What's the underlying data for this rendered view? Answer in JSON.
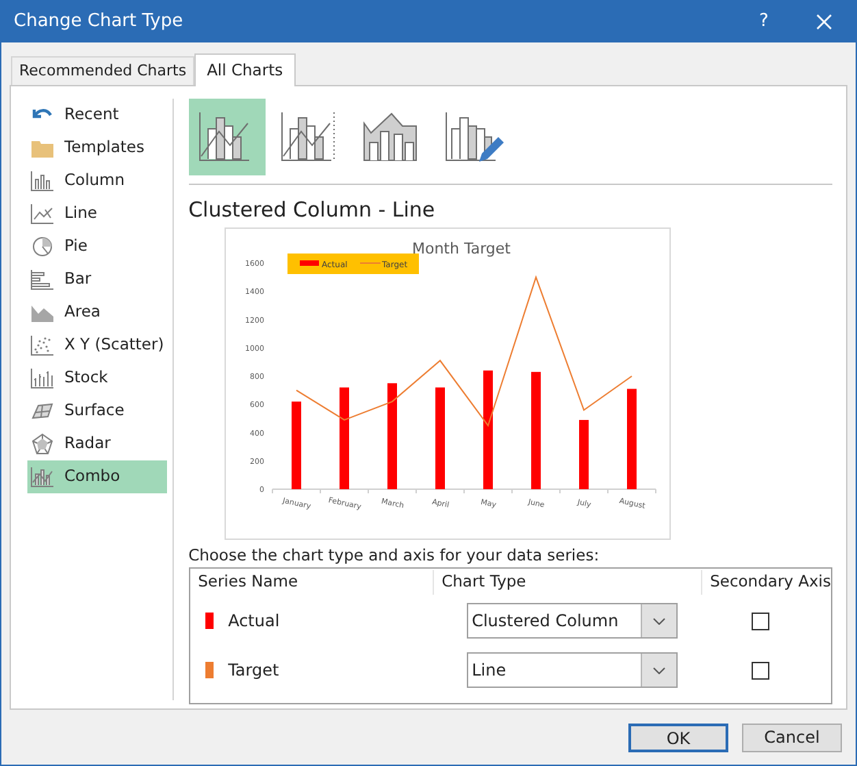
{
  "window": {
    "title": "Change Chart Type",
    "help": "?"
  },
  "tabs": [
    {
      "label": "Recommended Charts",
      "selected": false
    },
    {
      "label": "All Charts",
      "selected": true
    }
  ],
  "sidebar": {
    "items": [
      {
        "label": "Recent",
        "kind": "recent",
        "selected": false
      },
      {
        "label": "Templates",
        "kind": "templates",
        "selected": false
      },
      {
        "label": "Column",
        "kind": "column",
        "selected": false
      },
      {
        "label": "Line",
        "kind": "line",
        "selected": false
      },
      {
        "label": "Pie",
        "kind": "pie",
        "selected": false
      },
      {
        "label": "Bar",
        "kind": "bar",
        "selected": false
      },
      {
        "label": "Area",
        "kind": "area",
        "selected": false
      },
      {
        "label": "X Y (Scatter)",
        "kind": "scatter",
        "selected": false
      },
      {
        "label": "Stock",
        "kind": "stock",
        "selected": false
      },
      {
        "label": "Surface",
        "kind": "surface",
        "selected": false
      },
      {
        "label": "Radar",
        "kind": "radar",
        "selected": false
      },
      {
        "label": "Combo",
        "kind": "combo",
        "selected": true
      }
    ]
  },
  "subtypes": [
    {
      "kind": "column-line",
      "selected": true
    },
    {
      "kind": "column-line-secondary",
      "selected": false
    },
    {
      "kind": "area-column",
      "selected": false
    },
    {
      "kind": "custom",
      "selected": false
    }
  ],
  "subtype_title": "Clustered Column - Line",
  "preview": {
    "chart_data": {
      "type": "bar",
      "title": "Month Target",
      "categories": [
        "January",
        "February",
        "March",
        "April",
        "May",
        "June",
        "July",
        "August"
      ],
      "series": [
        {
          "name": "Actual",
          "type": "bar",
          "color": "#ff0000",
          "values": [
            620,
            720,
            750,
            720,
            840,
            830,
            490,
            710
          ]
        },
        {
          "name": "Target",
          "type": "line",
          "color": "#ed7d31",
          "values": [
            700,
            490,
            620,
            910,
            450,
            1500,
            560,
            800
          ]
        }
      ],
      "stacked": false,
      "legend": true,
      "ylim": [
        0,
        1600
      ],
      "yticks": [
        0,
        200,
        400,
        600,
        800,
        1000,
        1200,
        1400,
        1600
      ]
    }
  },
  "series_table": {
    "caption": "Choose the chart type and axis for your data series:",
    "columns": [
      "Series Name",
      "Chart Type",
      "Secondary Axis"
    ],
    "rows": [
      {
        "name": "Actual",
        "color": "#ff0000",
        "chart_type": "Clustered Column",
        "secondary_axis": false
      },
      {
        "name": "Target",
        "color": "#ed7d31",
        "chart_type": "Line",
        "secondary_axis": false
      }
    ]
  },
  "buttons": [
    {
      "label": "OK",
      "kind": "default"
    },
    {
      "label": "Cancel",
      "kind": "normal"
    }
  ]
}
